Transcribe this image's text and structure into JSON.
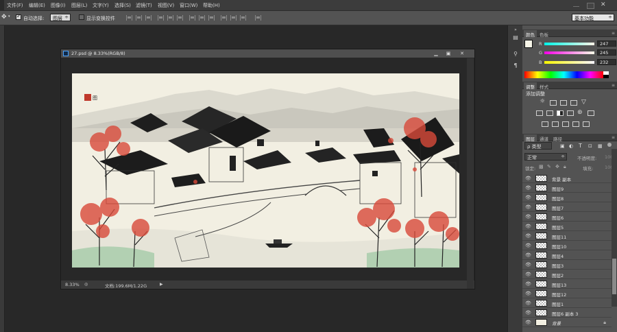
{
  "menubar": {
    "items": [
      "文件(F)",
      "编辑(E)",
      "图像(I)",
      "图层(L)",
      "文字(Y)",
      "选择(S)",
      "滤镜(T)",
      "视图(V)",
      "窗口(W)",
      "帮助(H)"
    ]
  },
  "options": {
    "auto_select_label": "自动选择:",
    "auto_select_value": "图层",
    "show_transform_label": "显示变换控件",
    "workspace": "基本功能"
  },
  "document": {
    "title": "27.psd @ 8.33%(RGB/8)",
    "zoom": "8.33%",
    "info": "文档:199.6M/1.22G"
  },
  "color_panel": {
    "tabs": [
      "颜色",
      "色板"
    ],
    "channels": [
      {
        "label": "R",
        "value": "247"
      },
      {
        "label": "G",
        "value": "245"
      },
      {
        "label": "B",
        "value": "232"
      }
    ],
    "foreground": "#f7f5e8",
    "background": "#000000"
  },
  "adjustments_panel": {
    "tabs": [
      "调整",
      "样式"
    ],
    "heading": "添加调整"
  },
  "layers_panel": {
    "tabs": [
      "图层",
      "通道",
      "路径"
    ],
    "filter_kind": "ρ 类型",
    "blend_mode": "正常",
    "opacity_label": "不透明度:",
    "opacity_value": "100%",
    "lock_label": "锁定:",
    "fill_label": "填充:",
    "fill_value": "100%",
    "layers": [
      "背景 副本",
      "图层9",
      "图层8",
      "图层7",
      "图层6",
      "图层5",
      "图层11",
      "图层10",
      "图层4",
      "图层3",
      "图层2",
      "图层13",
      "图层12",
      "图层1",
      "图层6 副本 3",
      "背景"
    ]
  }
}
